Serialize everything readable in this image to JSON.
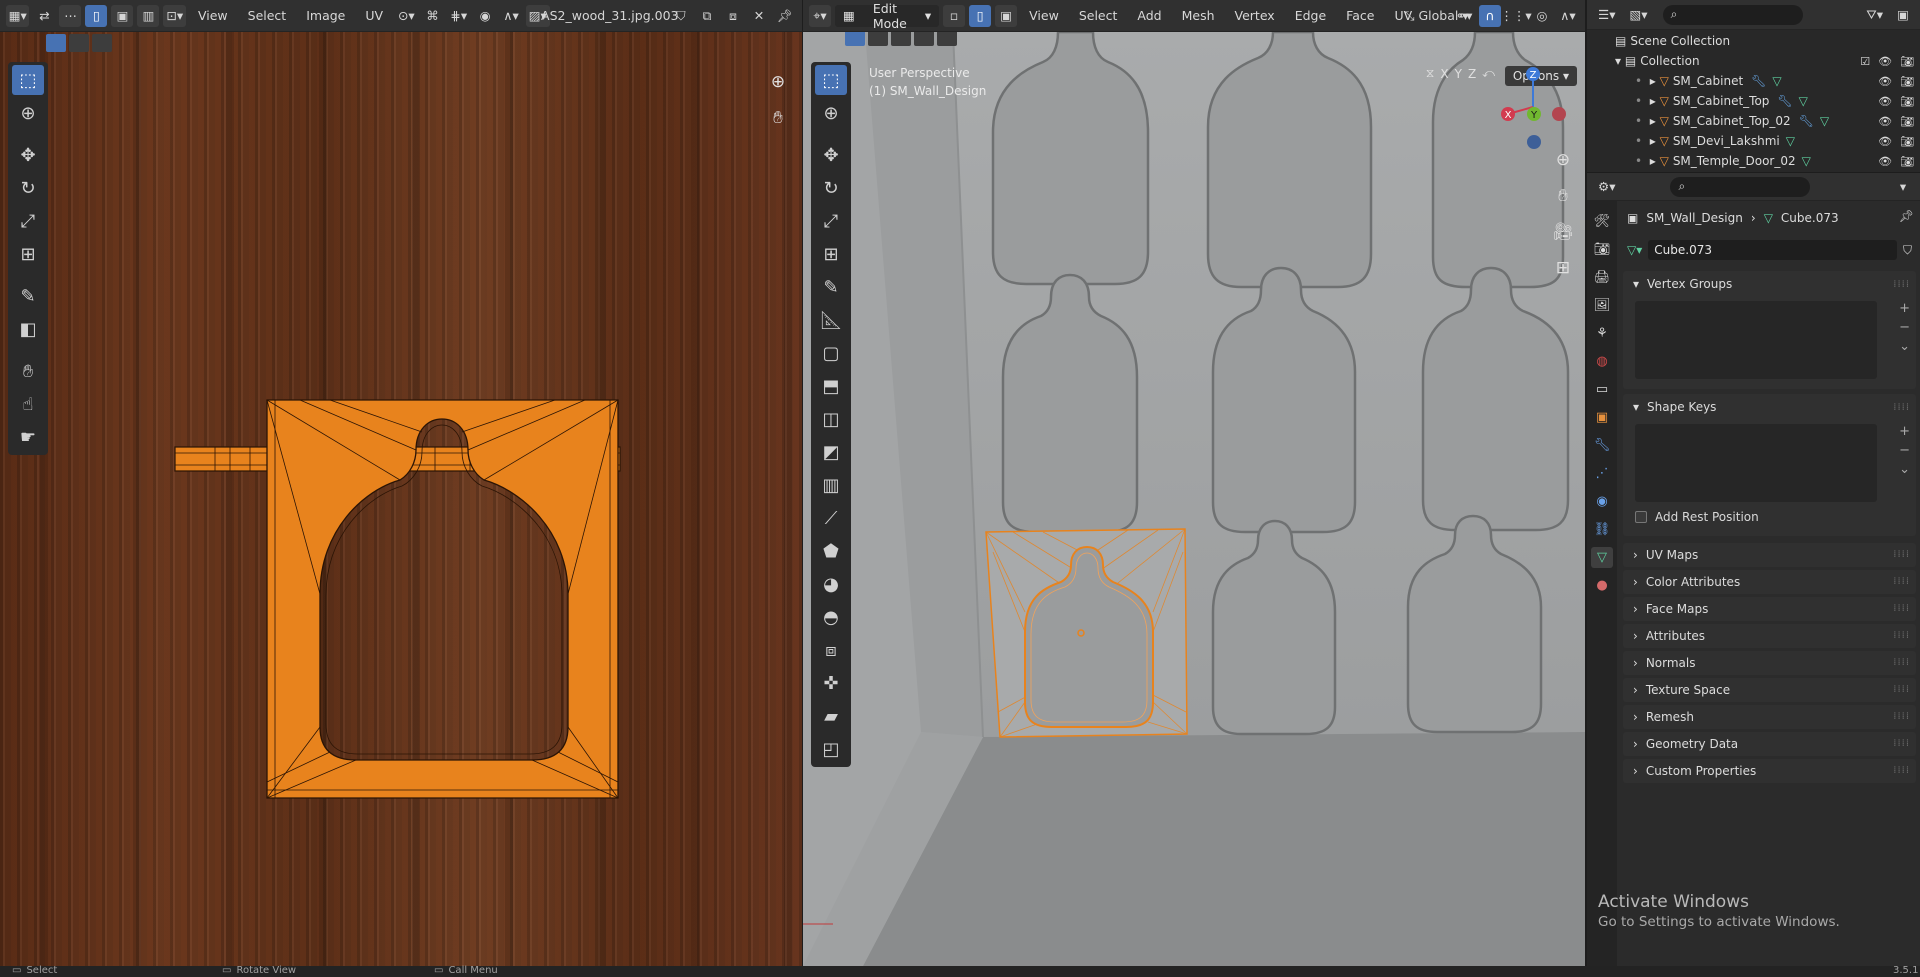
{
  "uv_editor": {
    "menus": [
      "View",
      "Select",
      "Image",
      "UV"
    ],
    "image_name": "AS2_wood_31.jpg.003"
  },
  "viewport": {
    "mode": "Edit Mode",
    "menus": [
      "View",
      "Select",
      "Add",
      "Mesh",
      "Vertex",
      "Edge",
      "Face",
      "UV"
    ],
    "transform_orientation": "Global",
    "info_line1": "User Perspective",
    "info_line2": "(1) SM_Wall_Design",
    "options_label": "Options",
    "axis_labels": [
      "X",
      "Y",
      "Z"
    ],
    "gizmo": {
      "x": "X",
      "y": "Y",
      "z": "Z"
    }
  },
  "outliner": {
    "scene_collection": "Scene Collection",
    "collection": "Collection",
    "objects": [
      "SM_Cabinet",
      "SM_Cabinet_Top",
      "SM_Cabinet_Top_02",
      "SM_Devi_Lakshmi",
      "SM_Temple_Door_02"
    ]
  },
  "properties": {
    "object_name": "SM_Wall_Design",
    "mesh_name": "Cube.073",
    "data_field_value": "Cube.073",
    "panels": {
      "vertex_groups": "Vertex Groups",
      "shape_keys": "Shape Keys",
      "add_rest_position": "Add Rest Position",
      "uv_maps": "UV Maps",
      "color_attributes": "Color Attributes",
      "face_maps": "Face Maps",
      "attributes": "Attributes",
      "normals": "Normals",
      "texture_space": "Texture Space",
      "remesh": "Remesh",
      "geometry_data": "Geometry Data",
      "custom_properties": "Custom Properties"
    }
  },
  "statusbar": {
    "select": "Select",
    "rotate_view": "Rotate View",
    "call_menu": "Call Menu",
    "version": "3.5.1"
  },
  "watermark": {
    "line1": "Activate Windows",
    "line2": "Go to Settings to activate Windows."
  },
  "colors": {
    "accent": "#4772b3",
    "selection_orange": "#e8831d",
    "viewport_bg": "#a3a5a6"
  }
}
